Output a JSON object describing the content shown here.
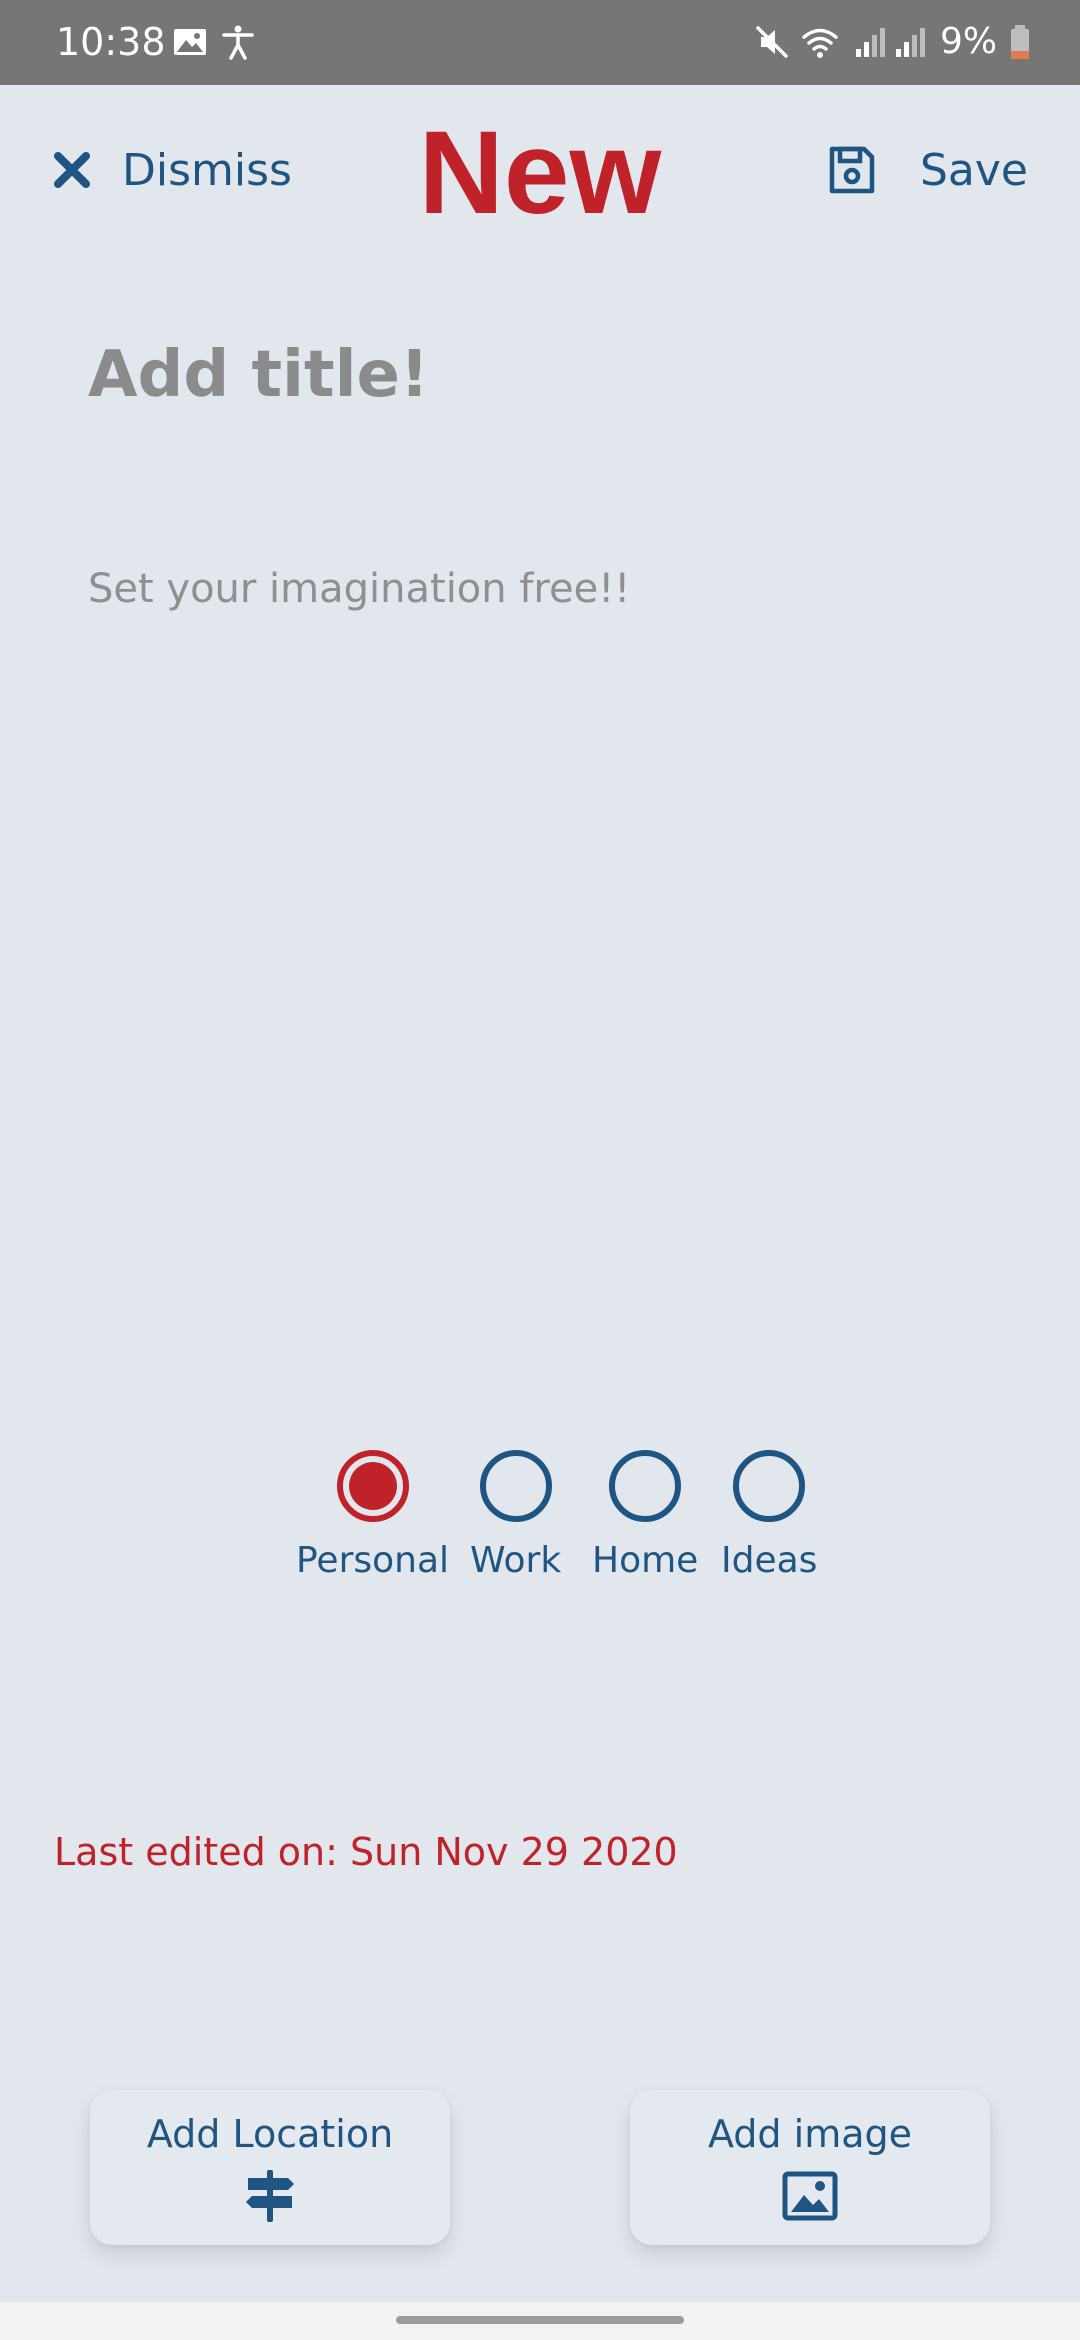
{
  "status_bar": {
    "time": "10:38",
    "battery": "9%",
    "icons": [
      "image-icon",
      "accessibility-icon",
      "mute-icon",
      "wifi-icon",
      "signal-icon",
      "signal-icon",
      "battery-icon"
    ]
  },
  "header": {
    "dismiss_label": "Dismiss",
    "title": "New",
    "save_label": "Save"
  },
  "note": {
    "title_placeholder": "Add title!",
    "body_placeholder": "Set your imagination free!!"
  },
  "categories": {
    "items": [
      {
        "label": "Personal",
        "selected": true
      },
      {
        "label": "Work",
        "selected": false
      },
      {
        "label": "Home",
        "selected": false
      },
      {
        "label": "Ideas",
        "selected": false
      }
    ]
  },
  "last_edited": "Last edited on: Sun Nov 29 2020",
  "actions": {
    "location_label": "Add Location",
    "image_label": "Add image"
  },
  "colors": {
    "accent_red": "#c0222a",
    "primary_blue": "#1f5582",
    "background": "#e2e6ed"
  }
}
